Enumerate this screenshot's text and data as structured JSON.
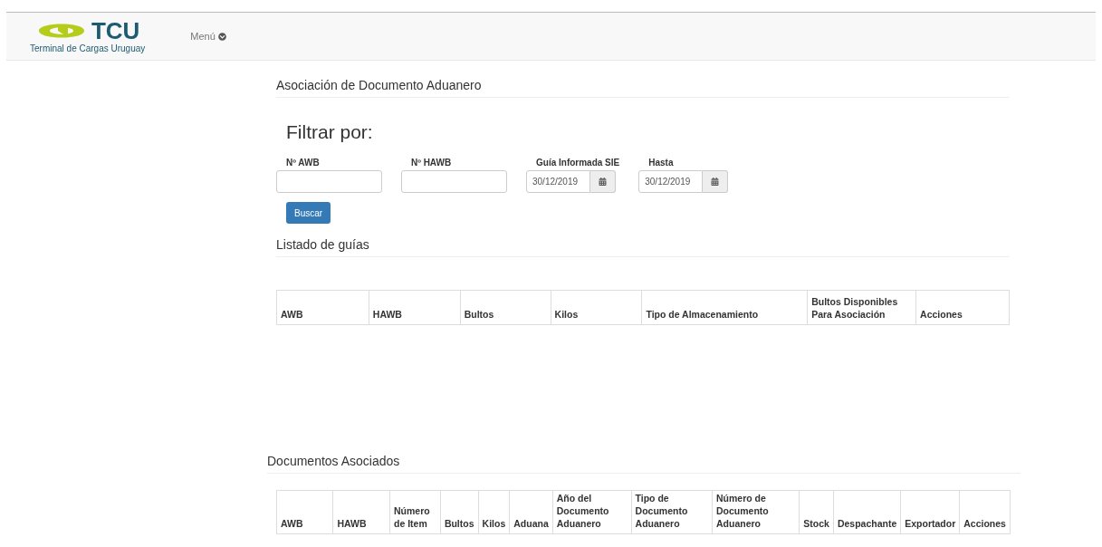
{
  "header": {
    "logo_text": "TCU",
    "logo_subtitle": "Terminal de Cargas Uruguay",
    "menu": "Menú"
  },
  "page_title": "Asociación de Documento Aduanero",
  "filter": {
    "title": "Filtrar por:",
    "fields": [
      {
        "kind": "text",
        "label": "Nº AWB"
      },
      {
        "kind": "text",
        "label": "Nº HAWB"
      },
      {
        "kind": "date",
        "label": "Guía Informada SIE",
        "value": "30/12/2019"
      },
      {
        "kind": "date",
        "label": "Hasta",
        "value": "30/12/2019"
      }
    ],
    "button": "Buscar"
  },
  "guides": {
    "title": "Listado de guías",
    "columns": [
      "AWB",
      "HAWB",
      "Bultos",
      "Kilos",
      "Tipo de Almacenamiento",
      "Bultos Disponibles Para Asociación",
      "Acciones"
    ]
  },
  "documents": {
    "title": "Documentos Asociados",
    "columns": [
      "AWB",
      "HAWB",
      "Número de Item",
      "Bultos",
      "Kilos",
      "Aduana",
      "Año del Documento Aduanero",
      "Tipo de Documento Aduanero",
      "Número de Documento Aduanero",
      "Stock",
      "Despachante",
      "Exportador",
      "Acciones"
    ]
  }
}
